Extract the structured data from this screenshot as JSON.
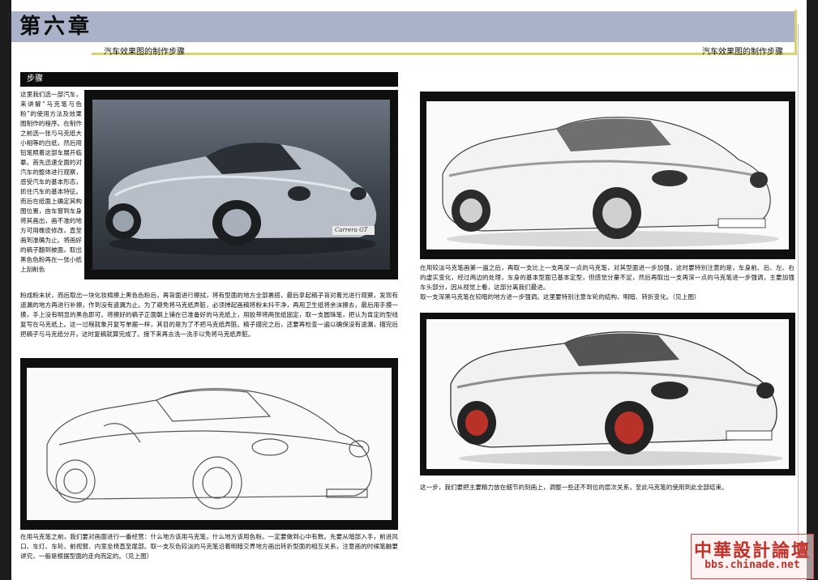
{
  "header": {
    "chapter": "第六章",
    "subtitle_left": "汽车效果图的制作步骤",
    "subtitle_right": "汽车效果图的制作步骤"
  },
  "section": {
    "title": "步骤"
  },
  "paragraphs": {
    "intro_narrow": "这里我们选一部汽车，来讲解“马克笔与色粉”的使用方法及效果图制作的程序。在制作之前选一张与马克纸大小相等的白纸，然后用铅笔照着这部车展开临摹。首先迅速全面的对汽车的整体进行观察，感受汽车的基本形态，抓住汽车的基本特征。而后在纸面上确定其构图位置，由车窗到车身将其画出，画不准的地方可用橡皮修改，直至画到准确为止。将画好的稿子翻到被面，取出黑色色粉再在一张小纸上刮削色",
    "intro_wide": "粉成粉末状，而后取出一块化妆棉擦上黑色色粉后，再背面进行擦拭，将有型面的地方全部裹搭，最后拿起稿子背对着光进行观察，发现有遗漏的地方再进行补擦，作到没有遗漏为止。为了避免将马克纸弄脏，必须掸起画稿将粉末抖干净，再用卫生纸将余沫擦去，最后用手摸一摸，手上没有明显的黑色即可。将擦好的稿子正面朝上铺在已准备好的马克纸上，用胶带将两张纸固定，取一支圆珠笔，把认为肯定的型线复写在马克纸上。这一过程就象开复写单据一样，其目的是为了不把马克纸弄脏。稿子描完之后，还要再检查一遍以确保没有遗漏，描完后把稿子与马克纸分开，这时复稿就算完成了。接下来再去洗一洗手以免将马克纸弄脏。",
    "step_line": "在用马克笔之前，我们要对画面进行一番经营：什么地方该用马克笔，什么地方该用色粉。一定要做到心中有数。先要从暗部入手，前进风口、车灯、车轮、前视窗、内室坐椅直至尾部。取一支灰色较淡的马克笔沿着明暗交界地方画出转折型面的相互关系，注意画的时候笔触要讲究，一般是根据型面的走向而定的。（见上图）",
    "step_shade": "在用较淡马克笔画第一遍之后，再取一支比上一支再深一点的马克笔，对其型面进一步加强，这时要特别注意的是，车身前、后、左、右的虚实变化，经过两边的处理，车身的基本型面已基本定型，但感觉分量不足，然后再取出一支再深一点的马克笔进一步强调，主要加强车头部分，因从视觉上看，这部分离我们最进。\n取一支深黑马克笔在较暗的地方进一步强调。这里要特别注意车轮的结构、明暗、转折变化。（见上图）",
    "step_final": "这一步，我们要把主要精力放在细节的刻画上，调整一些还不到位的层次关系，至此马克笔的使用到此全部结束。"
  },
  "images": {
    "photo": "silver-roadster-photo",
    "line_sketch": "roadster-line-sketch",
    "marker_sketch": "roadster-marker-sketch",
    "final_render": "roadster-final-render",
    "badge_text": "Carrera GT"
  },
  "watermark": {
    "cn": "中華設計論壇",
    "url": "bbs.chinade.net"
  },
  "colors": {
    "header_band": "#a9b2c9",
    "accent_yellow": "#d8d36a",
    "frame": "#0f0f0f",
    "watermark_red": "#c2302a",
    "wheel_red": "#b8322a"
  }
}
